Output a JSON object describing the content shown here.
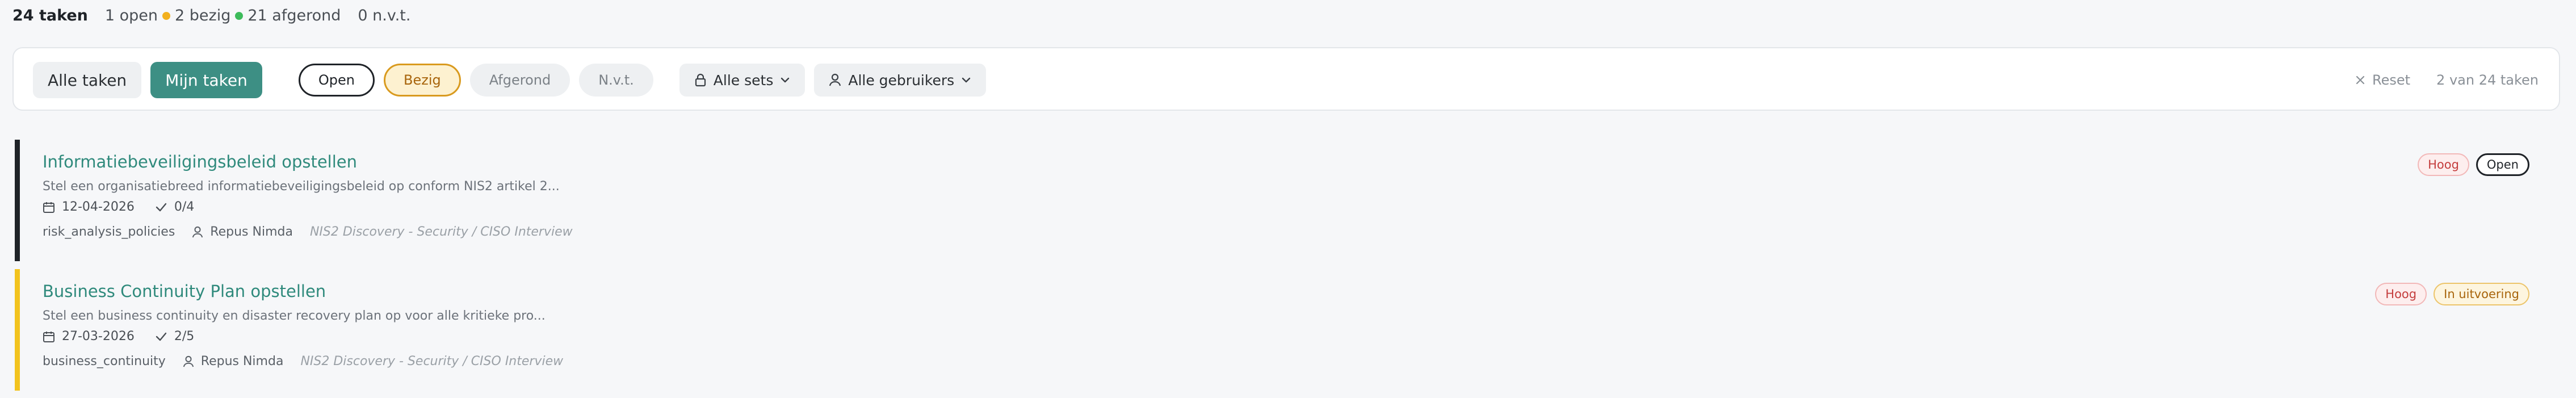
{
  "summary": {
    "total": "24 taken",
    "open": "1 open",
    "busy": "2 bezig",
    "done": "21 afgerond",
    "na": "0 n.v.t.",
    "colors": {
      "busy_dot": "#f2b01e",
      "done_dot": "#3dbb5b"
    }
  },
  "filters": {
    "scope_tabs": [
      {
        "label": "Alle taken",
        "active": false
      },
      {
        "label": "Mijn taken",
        "active": true
      }
    ],
    "status_pills": [
      {
        "label": "Open",
        "selected": true
      },
      {
        "label": "Bezig",
        "selected": true
      },
      {
        "label": "Afgerond",
        "selected": false
      },
      {
        "label": "N.v.t.",
        "selected": false
      }
    ],
    "sets_dropdown": {
      "label": "Alle sets",
      "icon": "lock-icon"
    },
    "users_dropdown": {
      "label": "Alle gebruikers",
      "icon": "user-icon"
    },
    "reset_label": "Reset",
    "count_label": "2 van 24 taken"
  },
  "tasks": [
    {
      "title": "Informatiebeveiligingsbeleid opstellen",
      "description": "Stel een organisatiebreed informatiebeveiligingsbeleid op conform NIS2 artikel 2...",
      "due_date": "12-04-2026",
      "checklist": "0/4",
      "category": "risk_analysis_policies",
      "assignee": "Repus Nimda",
      "source": "NIS2 Discovery - Security / CISO Interview",
      "priority": "Hoog",
      "status": "Open",
      "accent_color": "#1f2328"
    },
    {
      "title": "Business Continuity Plan opstellen",
      "description": "Stel een business continuity en disaster recovery plan op voor alle kritieke pro...",
      "due_date": "27-03-2026",
      "checklist": "2/5",
      "category": "business_continuity",
      "assignee": "Repus Nimda",
      "source": "NIS2 Discovery - Security / CISO Interview",
      "priority": "Hoog",
      "status": "In uitvoering",
      "accent_color": "#f2c31e"
    }
  ]
}
